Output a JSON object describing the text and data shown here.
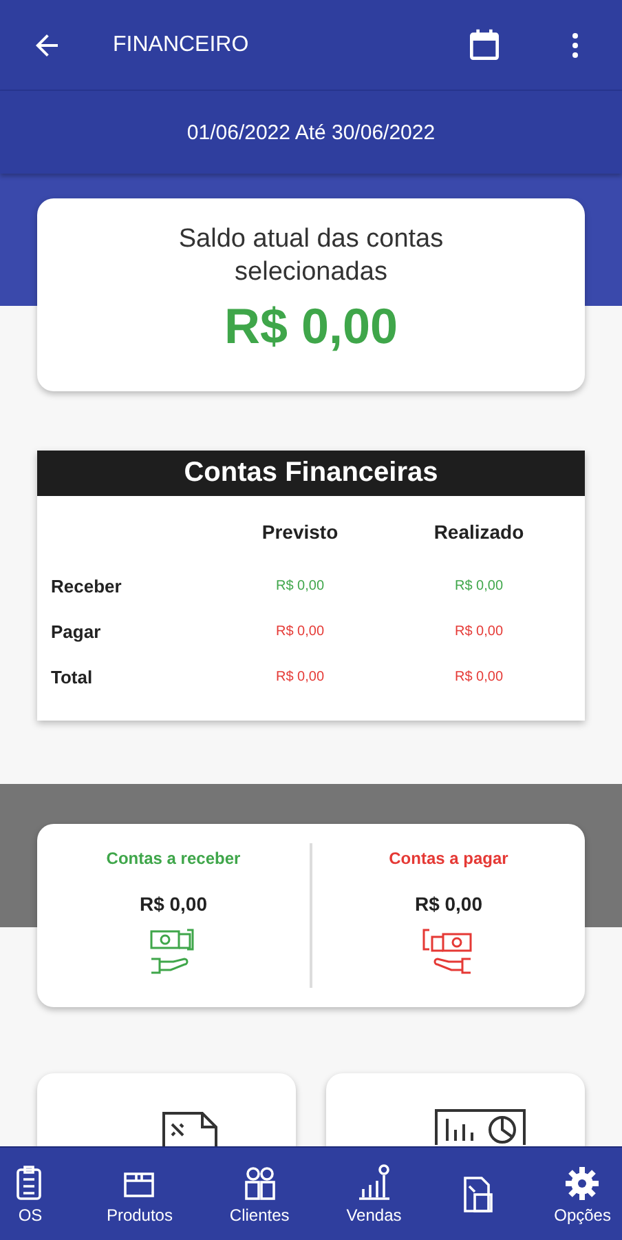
{
  "app_bar": {
    "title": "FINANCEIRO"
  },
  "period": "01/06/2022 Até 30/06/2022",
  "balance": {
    "title": "Saldo atual das contas selecionadas",
    "value": "R$ 0,00"
  },
  "accounts_table": {
    "title": "Contas Financeiras",
    "columns": [
      "Previsto",
      "Realizado"
    ],
    "rows": [
      {
        "label": "Receber",
        "kind": "income",
        "values": [
          "R$ 0,00",
          "R$ 0,00"
        ]
      },
      {
        "label": "Pagar",
        "kind": "expense",
        "values": [
          "R$ 0,00",
          "R$ 0,00"
        ]
      },
      {
        "label": "Total",
        "kind": "expense",
        "values": [
          "R$ 0,00",
          "R$ 0,00"
        ]
      }
    ]
  },
  "summary": [
    {
      "title": "Contas a receber",
      "kind": "income",
      "value": "R$ 0,00"
    },
    {
      "title": "Contas a pagar",
      "kind": "expense",
      "value": "R$ 0,00"
    }
  ],
  "bottom_nav": [
    {
      "label": "OS",
      "kind": "clipboard"
    },
    {
      "label": "Produtos",
      "kind": "box"
    },
    {
      "label": "Clientes",
      "kind": "people"
    },
    {
      "label": "Vendas",
      "kind": "chart"
    },
    {
      "kind": "report"
    },
    {
      "label": "Opções",
      "kind": "gear"
    }
  ]
}
